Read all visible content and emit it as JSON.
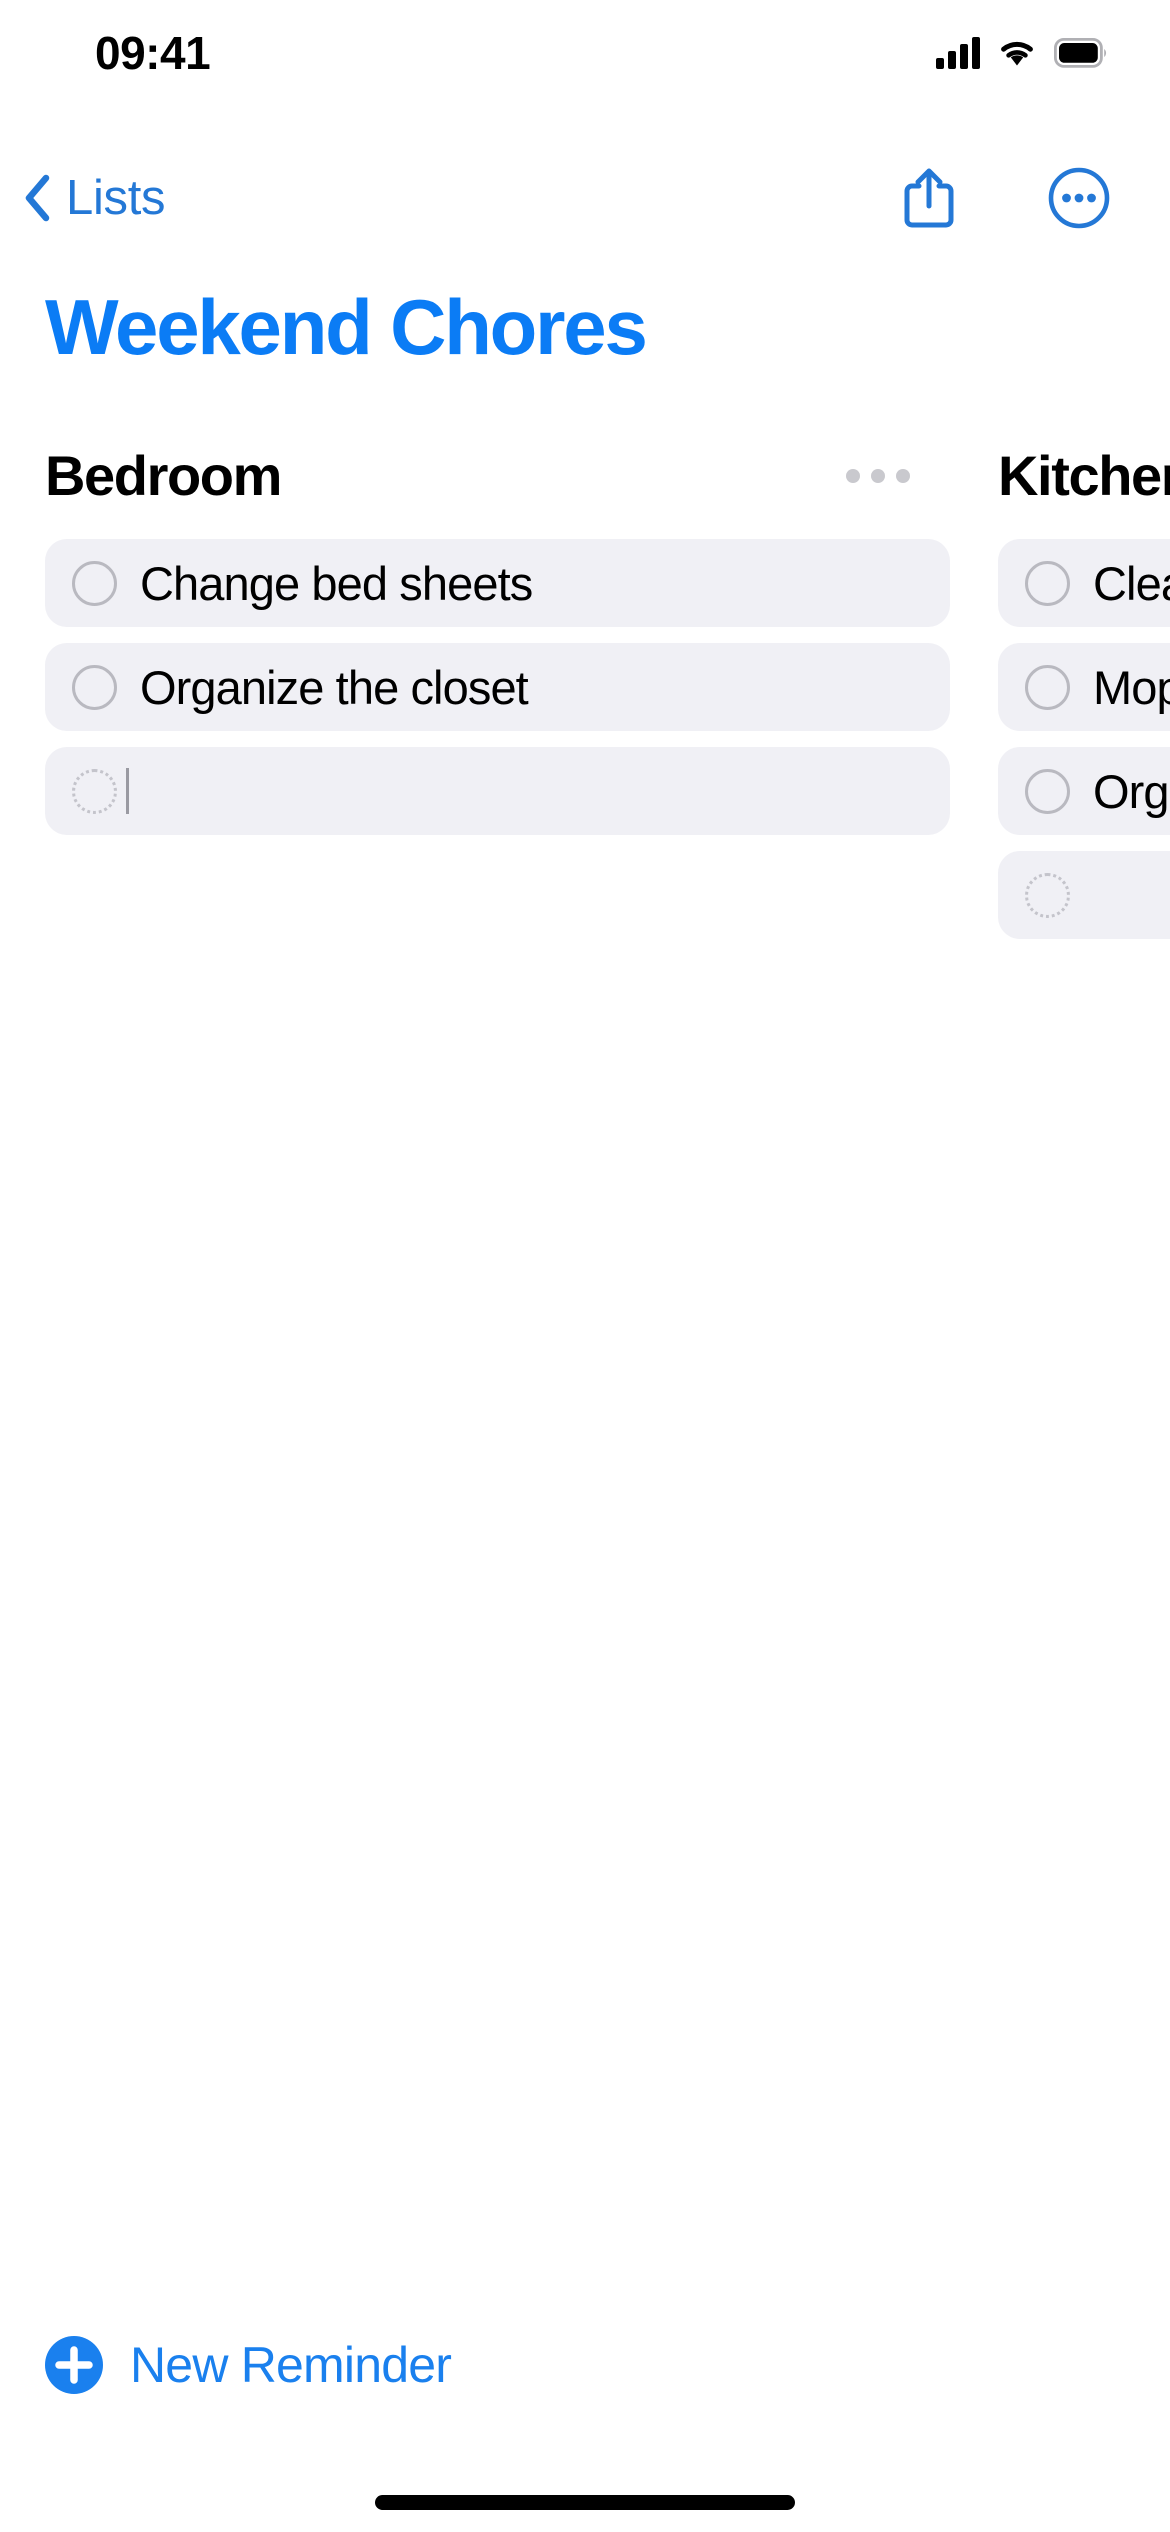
{
  "status_bar": {
    "time": "09:41",
    "cellular_icon": "cellular-signal-icon",
    "wifi_icon": "wifi-icon",
    "battery_icon": "battery-full-icon"
  },
  "nav": {
    "back_label": "Lists",
    "back_icon": "chevron-left-icon",
    "share_icon": "share-icon",
    "more_icon": "more-circle-icon"
  },
  "header": {
    "title": "Weekend Chores",
    "title_color": "#0b7cf5"
  },
  "columns": [
    {
      "title": "Bedroom",
      "more_icon": "section-more-icon",
      "reminders": [
        {
          "text": "Change bed sheets",
          "checkbox": "unchecked-circle-icon",
          "state": "unchecked"
        },
        {
          "text": "Organize the closet",
          "checkbox": "unchecked-circle-icon",
          "state": "unchecked"
        },
        {
          "text": "",
          "checkbox": "new-reminder-dotted-circle-icon",
          "state": "empty"
        }
      ]
    },
    {
      "title": "Kitchen",
      "more_icon": "section-more-icon",
      "reminders": [
        {
          "text": "Clean the counters",
          "checkbox": "unchecked-circle-icon",
          "state": "unchecked"
        },
        {
          "text": "Mop the floor",
          "checkbox": "unchecked-circle-icon",
          "state": "unchecked"
        },
        {
          "text": "Organize the pantry",
          "checkbox": "unchecked-circle-icon",
          "state": "unchecked"
        },
        {
          "text": "",
          "checkbox": "new-reminder-dotted-circle-icon",
          "state": "empty"
        }
      ]
    }
  ],
  "footer": {
    "new_reminder_label": "New Reminder",
    "new_reminder_icon": "plus-circle-filled-icon"
  },
  "theme": {
    "accent": "#0b7cf5",
    "nav_tint": "#2478d6",
    "row_background": "#f0f0f5",
    "checkbox_border": "#b9b9c0",
    "page_background": "#ffffff"
  }
}
